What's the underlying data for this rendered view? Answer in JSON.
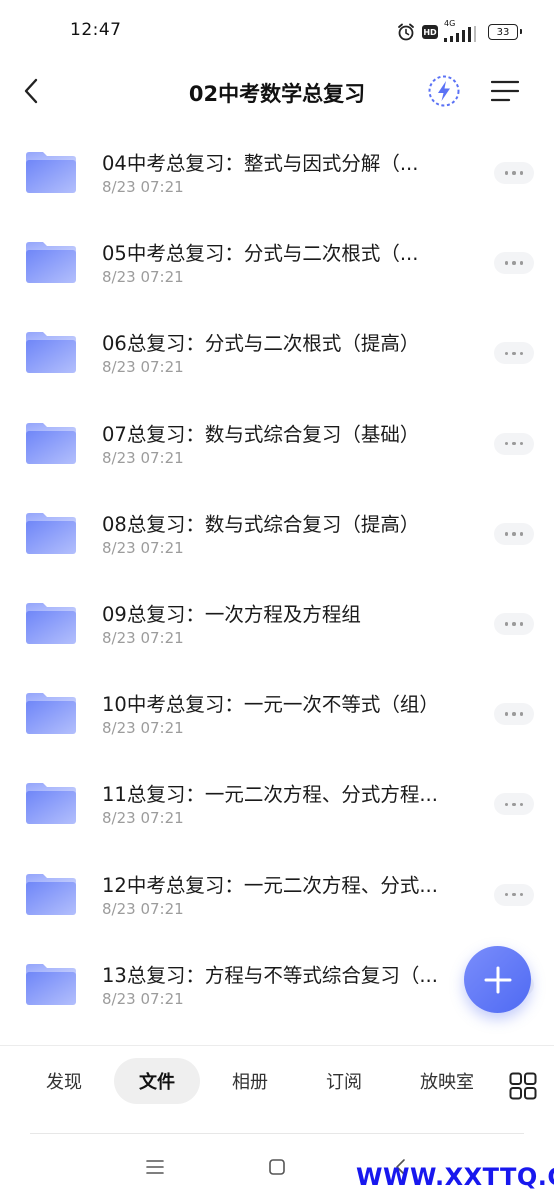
{
  "status_bar": {
    "time": "12:47",
    "hd_label": "HD",
    "network_type": "4G",
    "battery_level": "33"
  },
  "header": {
    "title": "02中考数学总复习"
  },
  "files": [
    {
      "name": "04中考总复习：整式与因式分解（...",
      "date": "8/23 07:21"
    },
    {
      "name": "05中考总复习：分式与二次根式（...",
      "date": "8/23 07:21"
    },
    {
      "name": "06总复习：分式与二次根式（提高）",
      "date": "8/23 07:21"
    },
    {
      "name": "07总复习：数与式综合复习（基础）",
      "date": "8/23 07:21"
    },
    {
      "name": "08总复习：数与式综合复习（提高）",
      "date": "8/23 07:21"
    },
    {
      "name": "09总复习：一次方程及方程组",
      "date": "8/23 07:21"
    },
    {
      "name": "10中考总复习：一元一次不等式（组）",
      "date": "8/23 07:21"
    },
    {
      "name": "11总复习：一元二次方程、分式方程...",
      "date": "8/23 07:21"
    },
    {
      "name": "12中考总复习：一元二次方程、分式...",
      "date": "8/23 07:21"
    },
    {
      "name": "13总复习：方程与不等式综合复习（...",
      "date": "8/23 07:21"
    }
  ],
  "bottom_nav": {
    "items": [
      {
        "label": "发现",
        "active": false
      },
      {
        "label": "文件",
        "active": true
      },
      {
        "label": "相册",
        "active": false
      },
      {
        "label": "订阅",
        "active": false
      },
      {
        "label": "放映室",
        "active": false
      }
    ]
  },
  "watermark": "WWW.XXTTQ.COM",
  "colors": {
    "accent": "#5b72f5",
    "folder_light": "#b3bffc",
    "folder_dark": "#6f86f8",
    "date_text": "#9c9c9c",
    "watermark": "#1818ee"
  },
  "icons": {
    "back": "chevron-left-icon",
    "flash": "lightning-icon",
    "menu": "menu-lines-icon",
    "folder": "folder-icon",
    "more": "more-dots-icon",
    "add": "plus-icon",
    "grid": "grid-icon"
  }
}
